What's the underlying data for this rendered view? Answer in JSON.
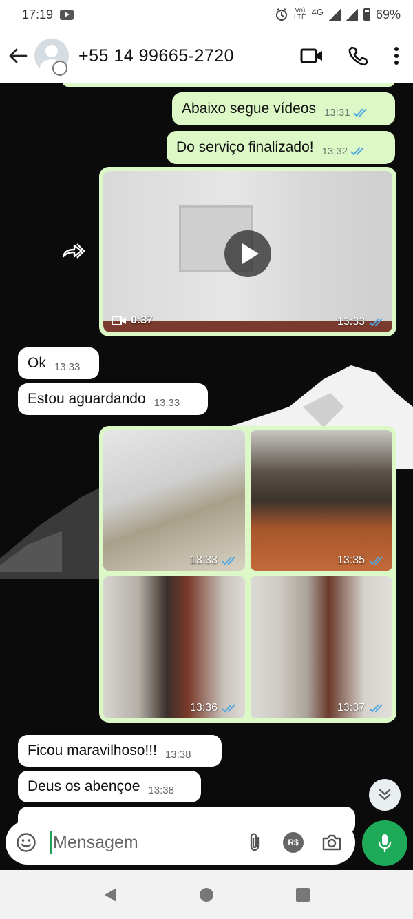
{
  "status_bar": {
    "time": "17:19",
    "network_badge_top": "Vo)",
    "network_badge_bottom": "LTE",
    "network_type": "4G",
    "battery": "69%"
  },
  "header": {
    "contact_name": "+55 14 99665-2720",
    "icons": [
      "back-arrow-icon",
      "avatar",
      "video-call-icon",
      "voice-call-icon",
      "more-icon"
    ]
  },
  "messages": [
    {
      "dir": "out",
      "text": "Abaixo segue vídeos",
      "time": "13:31",
      "read": true
    },
    {
      "dir": "out",
      "text": "Do serviço finalizado!",
      "time": "13:32",
      "read": true
    },
    {
      "dir": "out",
      "type": "video",
      "duration": "0:37",
      "time": "13:33",
      "read": true
    },
    {
      "dir": "in",
      "text": "Ok",
      "time": "13:33"
    },
    {
      "dir": "in",
      "text": "Estou aguardando",
      "time": "13:33"
    },
    {
      "dir": "out",
      "type": "photos",
      "photos": [
        {
          "time": "13:33"
        },
        {
          "time": "13:35"
        },
        {
          "time": "13:36"
        },
        {
          "time": "13:37"
        }
      ],
      "read": true
    },
    {
      "dir": "in",
      "text": "Ficou maravilhoso!!!",
      "time": "13:38"
    },
    {
      "dir": "in",
      "text": "Deus os abençoe",
      "time": "13:38"
    }
  ],
  "input": {
    "placeholder": "Mensagem",
    "currency_badge": "R$"
  },
  "colors": {
    "outgoing_bubble": "#dcf8c6",
    "incoming_bubble": "#ffffff",
    "read_tick": "#4fa8e0",
    "mic_button": "#1faa59",
    "chat_background": "#0b0b0b"
  }
}
